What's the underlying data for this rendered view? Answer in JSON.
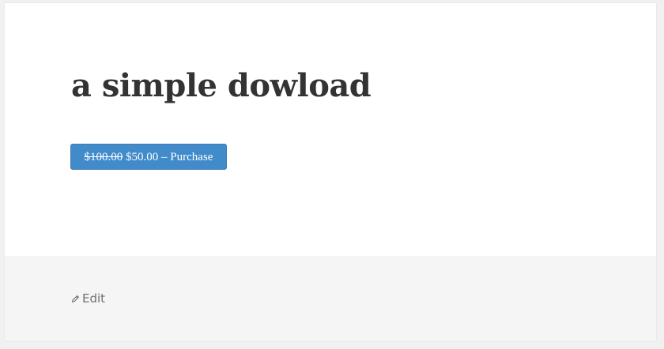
{
  "entry": {
    "title": "a simple dowload",
    "purchase_button": {
      "old_price": "$100.00",
      "new_price": "$50.00",
      "separator": "–",
      "label": "Purchase"
    },
    "colors": {
      "button": "#428bca",
      "title": "#333333"
    }
  },
  "footer": {
    "edit_label": "Edit",
    "edit_icon": "pencil-icon"
  }
}
